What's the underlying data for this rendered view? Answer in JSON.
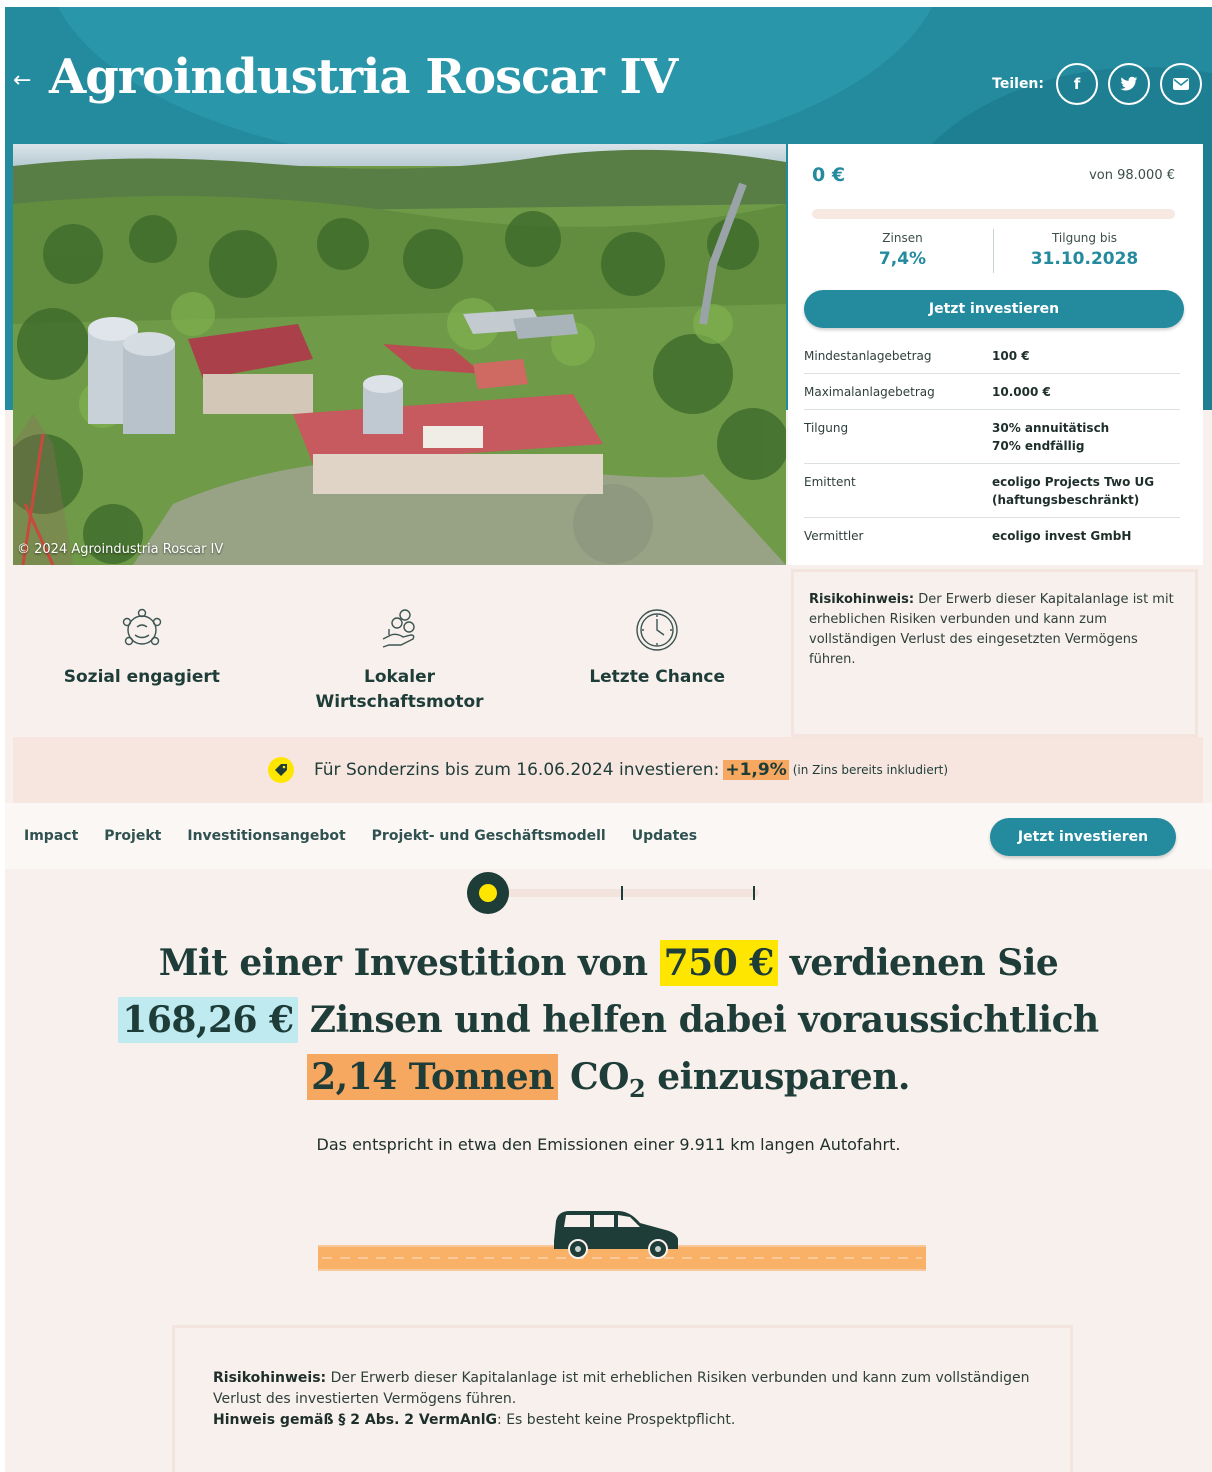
{
  "header": {
    "back_icon": "arrow-left-icon",
    "title": "Agroindustria Roscar IV",
    "share_label": "Teilen:",
    "share_buttons": [
      {
        "name": "facebook",
        "glyph": "f"
      },
      {
        "name": "twitter",
        "glyph": "t"
      },
      {
        "name": "email",
        "glyph": "✉"
      }
    ]
  },
  "photo": {
    "caption": "© 2024 Agroindustria Roscar IV"
  },
  "invest_card": {
    "amount": "0 €",
    "target": "von 98.000 €",
    "funding_progress": 0,
    "interest_label": "Zinsen",
    "interest_value": "7,4%",
    "repayment_label": "Tilgung bis",
    "repayment_value": "31.10.2028",
    "invest_button": "Jetzt investieren",
    "specs": [
      {
        "label": "Mindestanlagebetrag",
        "value": "100 €"
      },
      {
        "label": "Maximalanlagebetrag",
        "value": "10.000 €"
      },
      {
        "label": "Tilgung",
        "value": "30% annuitätisch",
        "value2": "70% endfällig"
      },
      {
        "label": "Emittent",
        "value": "ecoligo Projects Two UG",
        "value2": "(haftungsbeschränkt)"
      },
      {
        "label": "Vermittler",
        "value": "ecoligo invest GmbH"
      }
    ]
  },
  "features": [
    {
      "icon": "people-circle-icon",
      "line1": "Sozial engagiert",
      "line2": ""
    },
    {
      "icon": "hand-coins-icon",
      "line1": "Lokaler",
      "line2": "Wirtschaftsmotor"
    },
    {
      "icon": "clock-icon",
      "line1": "Letzte Chance",
      "line2": ""
    }
  ],
  "risk_notice": {
    "label": "Risikohinweis:",
    "text": " Der Erwerb dieser Kapitalanlage ist mit erheblichen Risiken verbunden und kann zum vollständigen Verlust des eingesetzten Vermögens führen."
  },
  "bonus": {
    "icon": "tag-icon",
    "text": "Für Sonderzins bis zum 16.06.2024 investieren:",
    "rate": "+1,9%",
    "note": "(in Zins bereits inkludiert)"
  },
  "nav": {
    "items": [
      "Impact",
      "Projekt",
      "Investitionsangebot",
      "Projekt- und Geschäftsmodell",
      "Updates"
    ],
    "button": "Jetzt investieren"
  },
  "slider": {
    "position": 0,
    "ticks": 3
  },
  "headline": {
    "part1": "Mit einer Investition von",
    "investment": "750 €",
    "part2": "verdienen Sie",
    "interest": "168,26 €",
    "part3": "Zinsen und helfen dabei voraussichtlich",
    "co2_amount": "2,14 Tonnen",
    "co2_prefix": "CO",
    "co2_sub": "2",
    "part4": "einzusparen."
  },
  "equivalent": "Das entspricht in etwa den Emissionen einer 9.911 km langen Autofahrt.",
  "bottom_notice": {
    "risk_label": "Risikohinweis:",
    "risk_text": " Der Erwerb dieser Kapitalanlage ist mit erheblichen Risiken verbunden und kann zum vollständigen Verlust des investierten Vermögens führen.",
    "law_label": "Hinweis gemäß § 2 Abs. 2 VermAnlG",
    "law_text": ": Es besteht keine Prospektpflicht."
  },
  "colors": {
    "teal": "#248b9f",
    "dark_green": "#1e3c38",
    "yellow": "#ffe600",
    "light_blue": "#bfeaf0",
    "orange": "#f7a860",
    "background": "#f8f0ec"
  }
}
